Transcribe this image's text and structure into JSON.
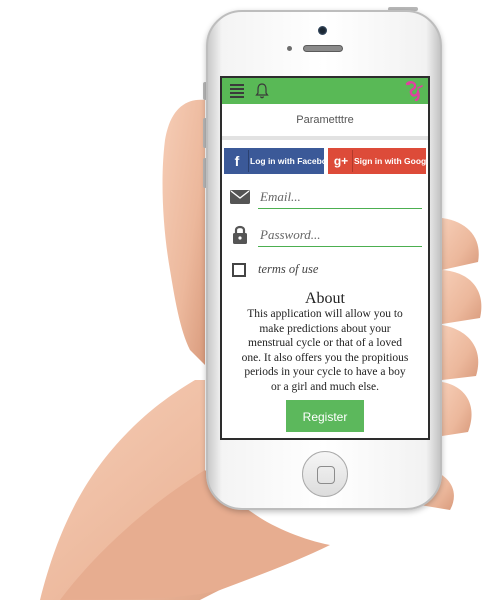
{
  "header": {
    "menu_icon": "hamburger-menu-icon",
    "notification_icon": "bell-icon",
    "logo_icon": "pink-seahorse-logo-icon",
    "colors": {
      "topbar": "#59b956",
      "accent": "#4caf50"
    }
  },
  "subheader": {
    "title": "Parametttre"
  },
  "social": {
    "facebook": {
      "icon": "f",
      "label": "Log in with Facebook",
      "color": "#3b5998"
    },
    "google": {
      "icon": "g+",
      "label": "Sign in with Google",
      "color": "#dd4b39"
    }
  },
  "form": {
    "email": {
      "placeholder": "Email...",
      "icon": "envelope-icon"
    },
    "password": {
      "placeholder": "Password...",
      "icon": "lock-icon"
    },
    "terms_label": "terms of use"
  },
  "about": {
    "title": "About",
    "lines": [
      "This application will allow you to",
      "make predictions about your",
      "menstrual cycle or that of a loved",
      "one. It also offers you the propitious",
      "periods in your cycle to have a boy",
      "or a girl and much else."
    ]
  },
  "register_label": "Register"
}
